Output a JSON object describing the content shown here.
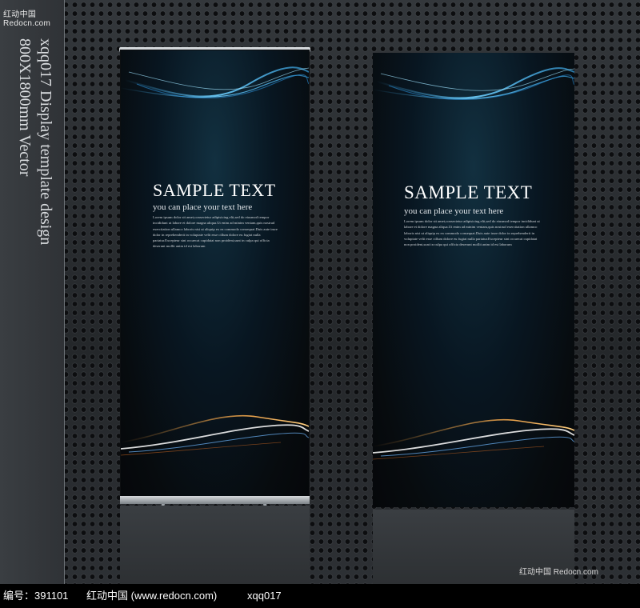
{
  "watermark_top": "红动中国 Redocn.com",
  "vertical_caption": "xqq017 Display template design\n800X1800mm Vector",
  "banners": [
    {
      "title": "SAMPLE TEXT",
      "subtitle": "you can place your text here",
      "body": "Lorem ipsum dolor sit amet,consectetur adipisicing elit,sed do eiusmod tempor incididunt ut labore et dolore magna aliqua.Ut enim ad minim veniam,quis nostrud exercitation ullamco laboris nisi ut aliquip ex ea commodo consequat.Duis aute irure dolor in reprehenderit in voluptate velit esse cillum dolore eu fugiat nulla pariatur.Excepteur sint occaecat cupidatat non proident,sunt in culpa qui officia deserunt mollit anim id est laborum"
    },
    {
      "title": "SAMPLE TEXT",
      "subtitle": "you can place your text here",
      "body": "Lorem ipsum dolor sit amet,consectetur adipisicing elit,sed do eiusmod tempor incididunt ut labore et dolore magna aliqua.Ut enim ad minim veniam,quis nostrud exercitation ullamco laboris nisi ut aliquip ex ea commodo consequat.Duis aute irure dolor in reprehenderit in voluptate velit esse cillum dolore eu fugiat nulla pariatur.Excepteur sint occaecat cupidatat non proident,sunt in culpa qui officia deserunt mollit anim id est laborum"
    }
  ],
  "watermark_bottom_right": "红动中国 Redocn.com",
  "footer": {
    "id_text": "编号：391101",
    "site_text": "红动中国 (www.redocn.com)",
    "code_text": "xqq017"
  },
  "colors": {
    "wave_blue": "#3fb8ff",
    "wave_orange": "#f0a040",
    "background": "#26292c"
  }
}
